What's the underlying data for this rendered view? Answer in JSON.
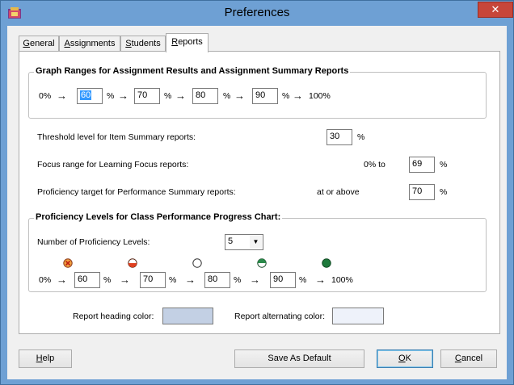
{
  "window": {
    "title": "Preferences",
    "close_glyph": "✕",
    "accent": "#6ea0d4"
  },
  "tabs": [
    {
      "label_pre": "",
      "label_ul": "G",
      "label_post": "eneral"
    },
    {
      "label_pre": "",
      "label_ul": "A",
      "label_post": "ssignments"
    },
    {
      "label_pre": "",
      "label_ul": "S",
      "label_post": "tudents"
    },
    {
      "label_pre": "",
      "label_ul": "R",
      "label_post": "eports"
    }
  ],
  "graph_ranges": {
    "title": "Graph Ranges for Assignment Results and Assignment Summary Reports",
    "start_label": "0%",
    "end_label": "100%",
    "pct": "%",
    "values": [
      "60",
      "70",
      "80",
      "90"
    ]
  },
  "settings": {
    "threshold_label": "Threshold level for Item Summary reports:",
    "threshold_value": "30",
    "focus_label": "Focus range for Learning Focus reports:",
    "focus_from": "0%  to",
    "focus_value": "69",
    "proficiency_label": "Proficiency target for Performance Summary reports:",
    "proficiency_qualifier": "at or above",
    "proficiency_value": "70",
    "pct": "%"
  },
  "proficiency_levels": {
    "title": "Proficiency Levels for Class Performance Progress Chart:",
    "count_label": "Number of Proficiency Levels:",
    "count_value": "5",
    "start_label": "0%",
    "end_label": "100%",
    "pct": "%",
    "values": [
      "60",
      "70",
      "80",
      "90"
    ],
    "level_icons": [
      "level-1-icon",
      "level-2-icon",
      "level-3-icon",
      "level-4-icon",
      "level-5-icon"
    ]
  },
  "colors": {
    "heading_label": "Report heading color:",
    "heading_color": "#c3d0e4",
    "alternating_label": "Report alternating color:",
    "alternating_color": "#eef2fa"
  },
  "buttons": {
    "help": {
      "label_pre": "",
      "label_ul": "H",
      "label_post": "elp"
    },
    "save_default": {
      "label": "Save As Default"
    },
    "ok": {
      "label_pre": "",
      "label_ul": "O",
      "label_post": "K"
    },
    "cancel": {
      "label_pre": "",
      "label_ul": "C",
      "label_post": "ancel"
    }
  }
}
